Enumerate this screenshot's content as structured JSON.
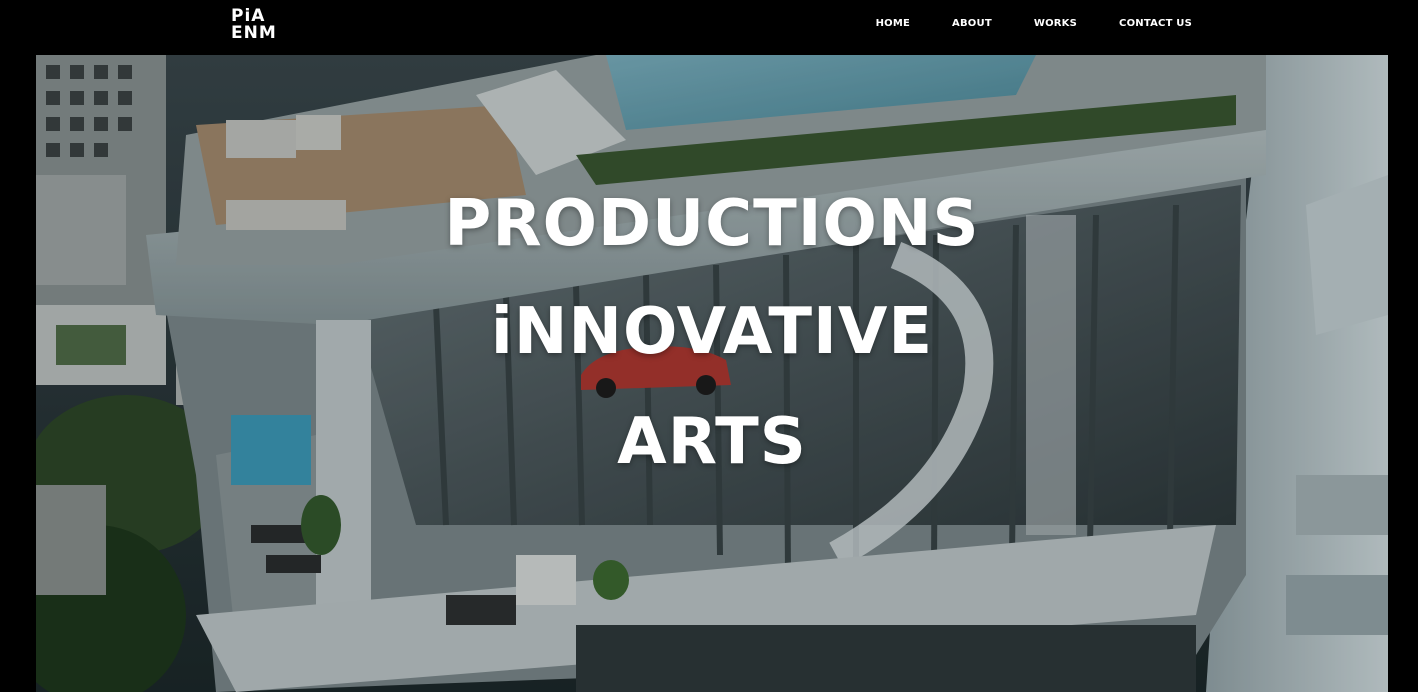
{
  "brand": {
    "logo_line1": "PiA",
    "logo_line2": "ENM"
  },
  "nav": {
    "items": [
      "HOME",
      "ABOUT",
      "WORKS",
      "CONTACT US"
    ]
  },
  "hero": {
    "lines": [
      "PRODUCTIONS",
      "iNNOVATIVE",
      "ARTS"
    ],
    "image_subject": "rendering of a modern high-rise building with rooftop terrace, pool, glass facade and red sports car inside"
  }
}
